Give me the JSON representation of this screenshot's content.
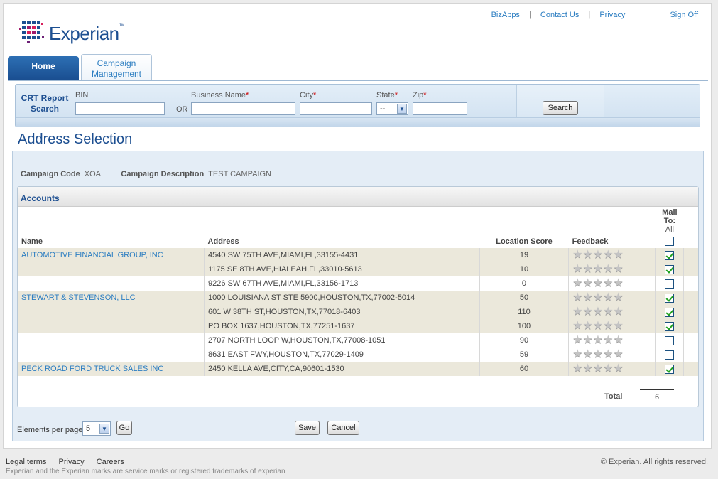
{
  "brand": {
    "name": "Experian",
    "tm": "™"
  },
  "top_links": {
    "bizapps": "BizApps",
    "contact": "Contact Us",
    "privacy": "Privacy",
    "signoff": "Sign Off",
    "separator": "|"
  },
  "tabs": {
    "home": "Home",
    "campaign_line1": "Campaign",
    "campaign_line2": "Management"
  },
  "search": {
    "title_line1": "CRT Report",
    "title_line2": "Search",
    "bin_label": "BIN",
    "or_label": "OR",
    "business_label": "Business Name",
    "city_label": "City",
    "state_label": "State",
    "zip_label": "Zip",
    "required_mark": "*",
    "state_value": "--",
    "button": "Search"
  },
  "page_title": "Address Selection",
  "campaign": {
    "code_label": "Campaign Code",
    "code_value": "XOA",
    "desc_label": "Campaign Description",
    "desc_value": "TEST CAMPAIGN"
  },
  "accounts": {
    "title": "Accounts",
    "columns": {
      "name": "Name",
      "address": "Address",
      "score": "Location Score",
      "feedback": "Feedback",
      "mailto": "Mail To:",
      "mailto_all": "All"
    },
    "rows": [
      {
        "name": "AUTOMOTIVE FINANCIAL GROUP, INC",
        "address": "4540 SW 75TH AVE,MIAMI,FL,33155-4431",
        "score": "19",
        "checked": true,
        "group": "odd"
      },
      {
        "name": "",
        "address": "1175 SE 8TH AVE,HIALEAH,FL,33010-5613",
        "score": "10",
        "checked": true,
        "group": "odd"
      },
      {
        "name": "",
        "address": "9226 SW 67TH AVE,MIAMI,FL,33156-1713",
        "score": "0",
        "checked": false,
        "group": "even"
      },
      {
        "name": "STEWART & STEVENSON, LLC",
        "address": "1000 LOUISIANA ST STE 5900,HOUSTON,TX,77002-5014",
        "score": "50",
        "checked": true,
        "group": "odd"
      },
      {
        "name": "",
        "address": "601 W 38TH ST,HOUSTON,TX,77018-6403",
        "score": "110",
        "checked": true,
        "group": "odd"
      },
      {
        "name": "",
        "address": "PO BOX 1637,HOUSTON,TX,77251-1637",
        "score": "100",
        "checked": true,
        "group": "odd"
      },
      {
        "name": "",
        "address": "2707 NORTH LOOP W,HOUSTON,TX,77008-1051",
        "score": "90",
        "checked": false,
        "group": "even"
      },
      {
        "name": "",
        "address": "8631 EAST FWY,HOUSTON,TX,77029-1409",
        "score": "59",
        "checked": false,
        "group": "even"
      },
      {
        "name": "PECK ROAD FORD TRUCK SALES INC",
        "address": "2450 KELLA AVE,CITY,CA,90601-1530",
        "score": "60",
        "checked": true,
        "group": "odd"
      }
    ],
    "total_label": "Total",
    "total_value": "6"
  },
  "pager": {
    "label": "Elements per page",
    "value": "5",
    "go": "Go"
  },
  "actions": {
    "save": "Save",
    "cancel": "Cancel"
  },
  "footer": {
    "legal": "Legal terms",
    "privacy": "Privacy",
    "careers": "Careers",
    "note": "Experian and the Experian marks are service marks or registered trademarks of experian",
    "copyright": "© Experian. All rights reserved."
  }
}
